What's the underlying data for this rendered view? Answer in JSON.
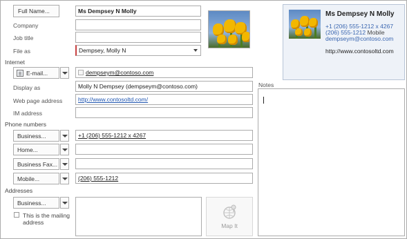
{
  "form": {
    "full_name_button": "Full Name...",
    "full_name_value": "Ms Dempsey N Molly",
    "company_label": "Company",
    "company_value": "",
    "job_title_label": "Job title",
    "job_title_value": "",
    "file_as_label": "File as",
    "file_as_value": "Dempsey, Molly N",
    "internet_group": "Internet",
    "email_button": "E-mail...",
    "email_value": "dempseym@contoso.com",
    "display_as_label": "Display as",
    "display_as_value": "Molly N Dempsey (dempseym@contoso.com)",
    "web_page_label": "Web page address",
    "web_page_value": "http://www.contosoltd.com/",
    "im_label": "IM address",
    "im_value": "",
    "phone_group": "Phone numbers",
    "phones": [
      {
        "button": "Business...",
        "value": "+1 (206) 555-1212 x 4267"
      },
      {
        "button": "Home...",
        "value": ""
      },
      {
        "button": "Business Fax...",
        "value": ""
      },
      {
        "button": "Mobile...",
        "value": "(206) 555-1212"
      }
    ],
    "addresses_group": "Addresses",
    "address_button": "Business...",
    "address_value": "",
    "mailing_checkbox_label_1": "This is the mailing",
    "mailing_checkbox_label_2": "address",
    "mailing_checked": false,
    "map_it_label": "Map It",
    "notes_label": "Notes",
    "notes_value": ""
  },
  "card": {
    "name": "Ms Dempsey N Molly",
    "phone_business": "+1 (206) 555-1212 x 4267",
    "phone_mobile_number": "(206) 555-1212",
    "phone_mobile_type": "Mobile",
    "email": "dempseym@contoso.com",
    "web": "http://www.contosoltd.com"
  },
  "icons": {
    "address_book": "address-book-icon",
    "map": "map-pin-icon",
    "contact_photo": "tulip-photo"
  },
  "colors": {
    "link": "#1f55b0",
    "card_background": "#eef2f8",
    "border": "#ababab"
  }
}
